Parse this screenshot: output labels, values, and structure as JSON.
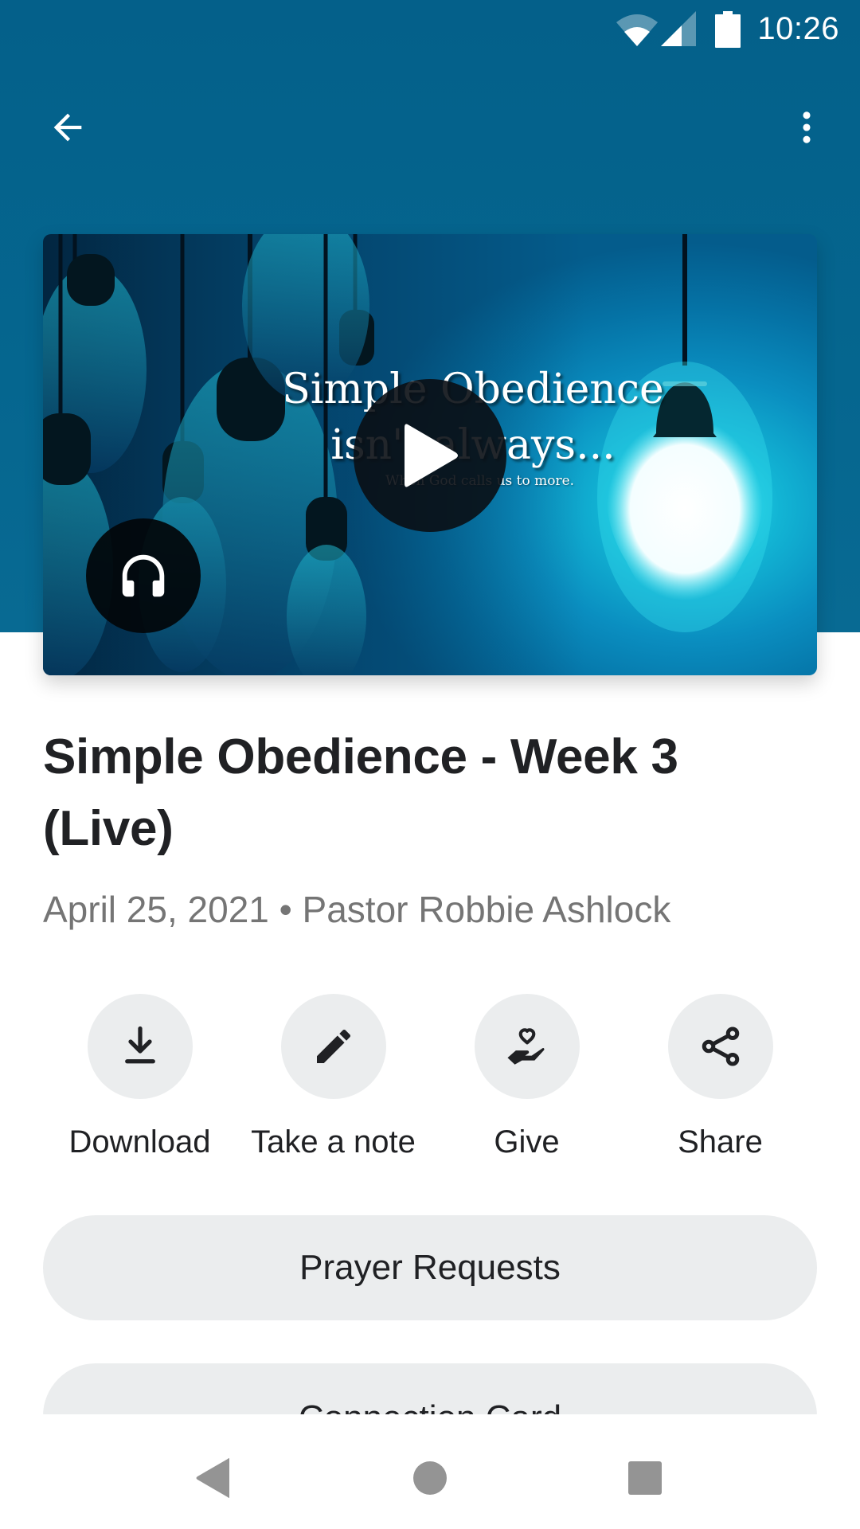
{
  "status_bar": {
    "time": "10:26",
    "icons": [
      "wifi-icon",
      "cellular-signal-icon",
      "battery-icon"
    ]
  },
  "toolbar": {
    "back_icon": "arrow-back-icon",
    "more_icon": "more-vertical-icon"
  },
  "video": {
    "slide_title_line1": "Simple Obedience",
    "slide_title_line2": "isn't always...",
    "slide_subtitle": "When God calls us to more.",
    "play_icon": "play-icon",
    "audio_icon": "headphones-icon"
  },
  "sermon": {
    "title": "Simple Obedience - Week 3 (Live)",
    "date": "April 25, 2021",
    "separator": "•",
    "speaker": "Pastor Robbie Ashlock"
  },
  "actions": [
    {
      "label": "Download",
      "icon": "download-icon"
    },
    {
      "label": "Take a note",
      "icon": "pencil-icon"
    },
    {
      "label": "Give",
      "icon": "hand-heart-icon"
    },
    {
      "label": "Share",
      "icon": "share-icon"
    }
  ],
  "buttons": {
    "prayer_requests": "Prayer Requests",
    "connection_card": "Connection Card"
  },
  "nav_bar": {
    "back": "nav-back-icon",
    "home": "nav-home-icon",
    "recents": "nav-recents-icon"
  },
  "colors": {
    "header_blue": "#05648e",
    "button_gray": "#ebedee",
    "text_primary": "#202124",
    "text_secondary": "#757575"
  }
}
